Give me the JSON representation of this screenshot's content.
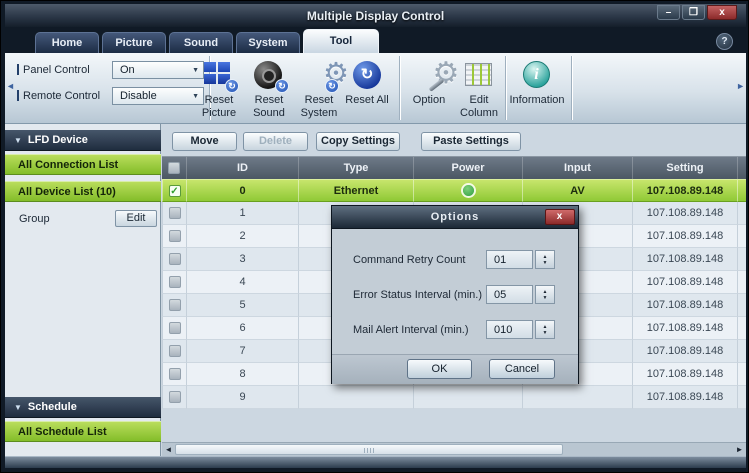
{
  "icons": {
    "minimize": "–",
    "maximize": "❐",
    "close": "x",
    "help": "?",
    "dropdown_arrow": "▼",
    "section_arrow": "▼",
    "scroll_left": "◄",
    "scroll_right": "►",
    "spinner_up": "▲",
    "spinner_down": "▼",
    "refresh": "↻",
    "gear": "⚙",
    "check": "✓",
    "info": "i"
  },
  "colors": {
    "accent_green": "#8cc733",
    "selected_row_green": "#9ed63f",
    "close_red": "#a83838",
    "info_teal": "#2fa8a0",
    "power_on_green": "#3fae49"
  },
  "window": {
    "title": "Multiple Display Control"
  },
  "tabs": {
    "active": "Tool",
    "items": [
      {
        "label": "Home"
      },
      {
        "label": "Picture"
      },
      {
        "label": "Sound"
      },
      {
        "label": "System"
      },
      {
        "label": "Tool"
      }
    ]
  },
  "toolbar": {
    "panel_control_label": "Panel Control",
    "panel_control_value": "On",
    "remote_control_label": "Remote Control",
    "remote_control_value": "Disable",
    "buttons": [
      {
        "label": "Reset Picture"
      },
      {
        "label": "Reset Sound"
      },
      {
        "label": "Reset System"
      },
      {
        "label": "Reset All"
      },
      {
        "label": "Option"
      },
      {
        "label": "Edit Column"
      },
      {
        "label": "Information"
      }
    ]
  },
  "sidebar": {
    "lfd_header": "LFD Device",
    "all_connection": "All Connection List",
    "all_device": "All Device List (10)",
    "group_label": "Group",
    "edit_label": "Edit",
    "schedule_header": "Schedule",
    "all_schedule": "All Schedule List"
  },
  "list_actions": [
    {
      "label": "Move",
      "enabled": true
    },
    {
      "label": "Delete",
      "enabled": false
    },
    {
      "label": "Copy Settings",
      "enabled": true
    },
    {
      "label": "Paste Settings",
      "enabled": true
    }
  ],
  "table": {
    "columns": [
      {
        "label": "ID"
      },
      {
        "label": "Type"
      },
      {
        "label": "Power"
      },
      {
        "label": "Input"
      },
      {
        "label": "Setting"
      }
    ],
    "rows": [
      {
        "id": "0",
        "type": "Ethernet",
        "power": "on",
        "input": "AV",
        "setting": "107.108.89.148",
        "checked": true,
        "selected": true
      },
      {
        "id": "1",
        "type": "",
        "power": "",
        "input": "",
        "setting": "107.108.89.148",
        "checked": false,
        "selected": false
      },
      {
        "id": "2",
        "type": "",
        "power": "",
        "input": "",
        "setting": "107.108.89.148",
        "checked": false,
        "selected": false
      },
      {
        "id": "3",
        "type": "",
        "power": "",
        "input": "",
        "setting": "107.108.89.148",
        "checked": false,
        "selected": false
      },
      {
        "id": "4",
        "type": "",
        "power": "",
        "input": "",
        "setting": "107.108.89.148",
        "checked": false,
        "selected": false
      },
      {
        "id": "5",
        "type": "",
        "power": "",
        "input": "",
        "setting": "107.108.89.148",
        "checked": false,
        "selected": false
      },
      {
        "id": "6",
        "type": "",
        "power": "",
        "input": "",
        "setting": "107.108.89.148",
        "checked": false,
        "selected": false
      },
      {
        "id": "7",
        "type": "",
        "power": "",
        "input": "",
        "setting": "107.108.89.148",
        "checked": false,
        "selected": false
      },
      {
        "id": "8",
        "type": "",
        "power": "",
        "input": "",
        "setting": "107.108.89.148",
        "checked": false,
        "selected": false
      },
      {
        "id": "9",
        "type": "",
        "power": "",
        "input": "",
        "setting": "107.108.89.148",
        "checked": false,
        "selected": false
      }
    ]
  },
  "dialog": {
    "title": "Options",
    "fields": [
      {
        "label": "Command Retry Count",
        "value": "01"
      },
      {
        "label": "Error Status Interval (min.)",
        "value": "05"
      },
      {
        "label": "Mail Alert Interval (min.)",
        "value": "010"
      }
    ],
    "ok_label": "OK",
    "cancel_label": "Cancel"
  }
}
